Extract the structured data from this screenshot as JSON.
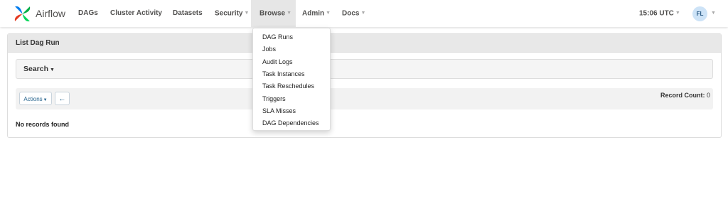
{
  "brand": {
    "name": "Airflow",
    "logo_icon": "airflow-pinwheel-icon"
  },
  "nav": {
    "items": [
      {
        "label": "DAGs"
      },
      {
        "label": "Cluster Activity"
      },
      {
        "label": "Datasets"
      },
      {
        "label": "Security",
        "has_caret": true
      },
      {
        "label": "Browse",
        "has_caret": true,
        "active": true
      },
      {
        "label": "Admin",
        "has_caret": true
      },
      {
        "label": "Docs",
        "has_caret": true
      }
    ],
    "caret_icon": "chevron-down-icon"
  },
  "time": {
    "label": "15:06 UTC"
  },
  "user": {
    "initials": "FL",
    "avatar_color": "#cde3f7"
  },
  "panel": {
    "title": "List Dag Run",
    "search_label": "Search",
    "actions_label": "Actions",
    "back_icon": "arrow-left-icon",
    "record_count_label": "Record Count:",
    "record_count_value": "0",
    "empty_message": "No records found"
  },
  "browse_menu": {
    "items": [
      "DAG Runs",
      "Jobs",
      "Audit Logs",
      "Task Instances",
      "Task Reschedules",
      "Triggers",
      "SLA Misses",
      "DAG Dependencies"
    ]
  },
  "colors": {
    "accent": "#1f5f8a",
    "nav_active_bg": "#e6e6e6",
    "heading_bg": "#e8e8e8"
  }
}
